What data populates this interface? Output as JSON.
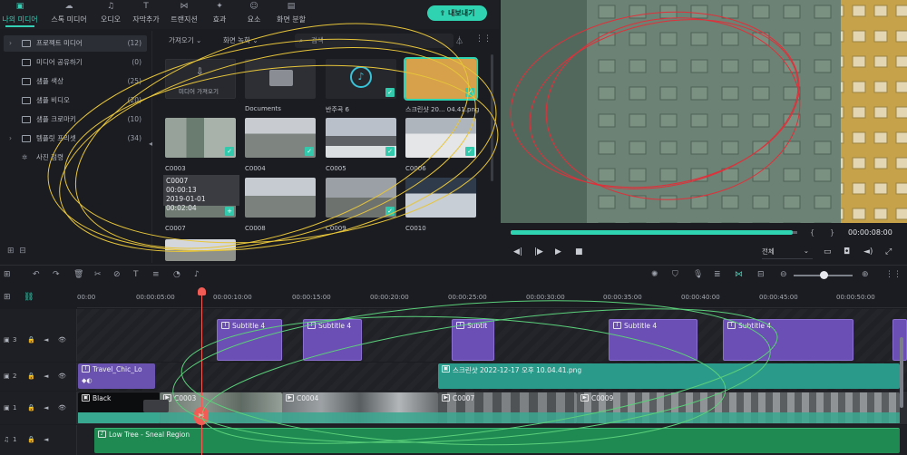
{
  "tabs": [
    {
      "label": "나의 미디어",
      "icon": "folder-media-icon",
      "active": true
    },
    {
      "label": "스톡 미디어",
      "icon": "cloud-icon"
    },
    {
      "label": "오디오",
      "icon": "music-note-icon"
    },
    {
      "label": "자막추가",
      "icon": "text-t-icon"
    },
    {
      "label": "트랜지션",
      "icon": "transition-icon"
    },
    {
      "label": "효과",
      "icon": "sparkle-icon"
    },
    {
      "label": "요소",
      "icon": "smiley-icon"
    },
    {
      "label": "화면 분할",
      "icon": "split-screen-icon"
    }
  ],
  "export_label": "내보내기",
  "sidebar": {
    "items": [
      {
        "label": "프로젝트 미디어",
        "count": "(12)",
        "selected": true,
        "expandable": true
      },
      {
        "label": "미디어 공유하기",
        "count": "(0)"
      },
      {
        "label": "샘플 색상",
        "count": "(25)"
      },
      {
        "label": "샘플 비디오",
        "count": "(20)"
      },
      {
        "label": "샘플 크로마키",
        "count": "(10)"
      },
      {
        "label": "템플릿 프리셋",
        "count": "(34)",
        "expandable": true
      },
      {
        "label": "사진 점령",
        "count": ""
      }
    ]
  },
  "media": {
    "import_dropdown": "가져오기",
    "record_dropdown": "화면 녹화",
    "search_placeholder": "검색",
    "import_tile_label": "미디어 가져오기",
    "items": [
      {
        "caption": "Documents",
        "kind": "folder"
      },
      {
        "caption": "반주곡 6",
        "kind": "audio",
        "checked": true
      },
      {
        "caption": "스크린샷 20... 04.41.png",
        "kind": "image",
        "checked": true
      },
      {
        "caption": "C0003",
        "kind": "video",
        "checked": true
      },
      {
        "caption": "C0004",
        "kind": "video",
        "checked": true
      },
      {
        "caption": "C0005",
        "kind": "video",
        "checked": true
      },
      {
        "caption": "C0006",
        "kind": "video",
        "checked": true
      },
      {
        "caption": "C0007",
        "kind": "video"
      },
      {
        "caption": "C0008",
        "kind": "video"
      },
      {
        "caption": "C0009",
        "kind": "video",
        "checked": true
      },
      {
        "caption": "C0010",
        "kind": "video"
      }
    ],
    "tooltip": {
      "name": "C0007",
      "duration": "00:00:13",
      "date": "2019-01-01 00:02:04"
    }
  },
  "preview": {
    "timecode": "00:00:08:00",
    "zoom": "전체",
    "progress": 0.985
  },
  "ruler": {
    "ticks": [
      "00:00",
      "00:00:05:00",
      "00:00:10:00",
      "00:00:15:00",
      "00:00:20:00",
      "00:00:25:00",
      "00:00:30:00",
      "00:00:35:00",
      "00:00:40:00",
      "00:00:45:00",
      "00:00:50:00"
    ]
  },
  "tracks": {
    "headers": [
      "3",
      "2",
      "1",
      "1"
    ],
    "subtitles": [
      "Subtitle 4",
      "Subtitle 4",
      "Subtit",
      "Subtitle 4",
      "Subtitle 4"
    ],
    "title_clip": "Travel_Chic_Lo",
    "image_clip": "스크린샷 2022-12-17 오후 10.04.41.png",
    "video_clips": [
      "Black",
      "C0003",
      "C0004",
      "C0007",
      "C0009"
    ],
    "audio_clip": "Low Tree - Sneal Region"
  },
  "colors": {
    "accent": "#2fd3b2",
    "playhead": "#f25c54",
    "subtitle": "#6c4fb4",
    "image": "#2a9b8a",
    "audio": "#1f8a52"
  }
}
